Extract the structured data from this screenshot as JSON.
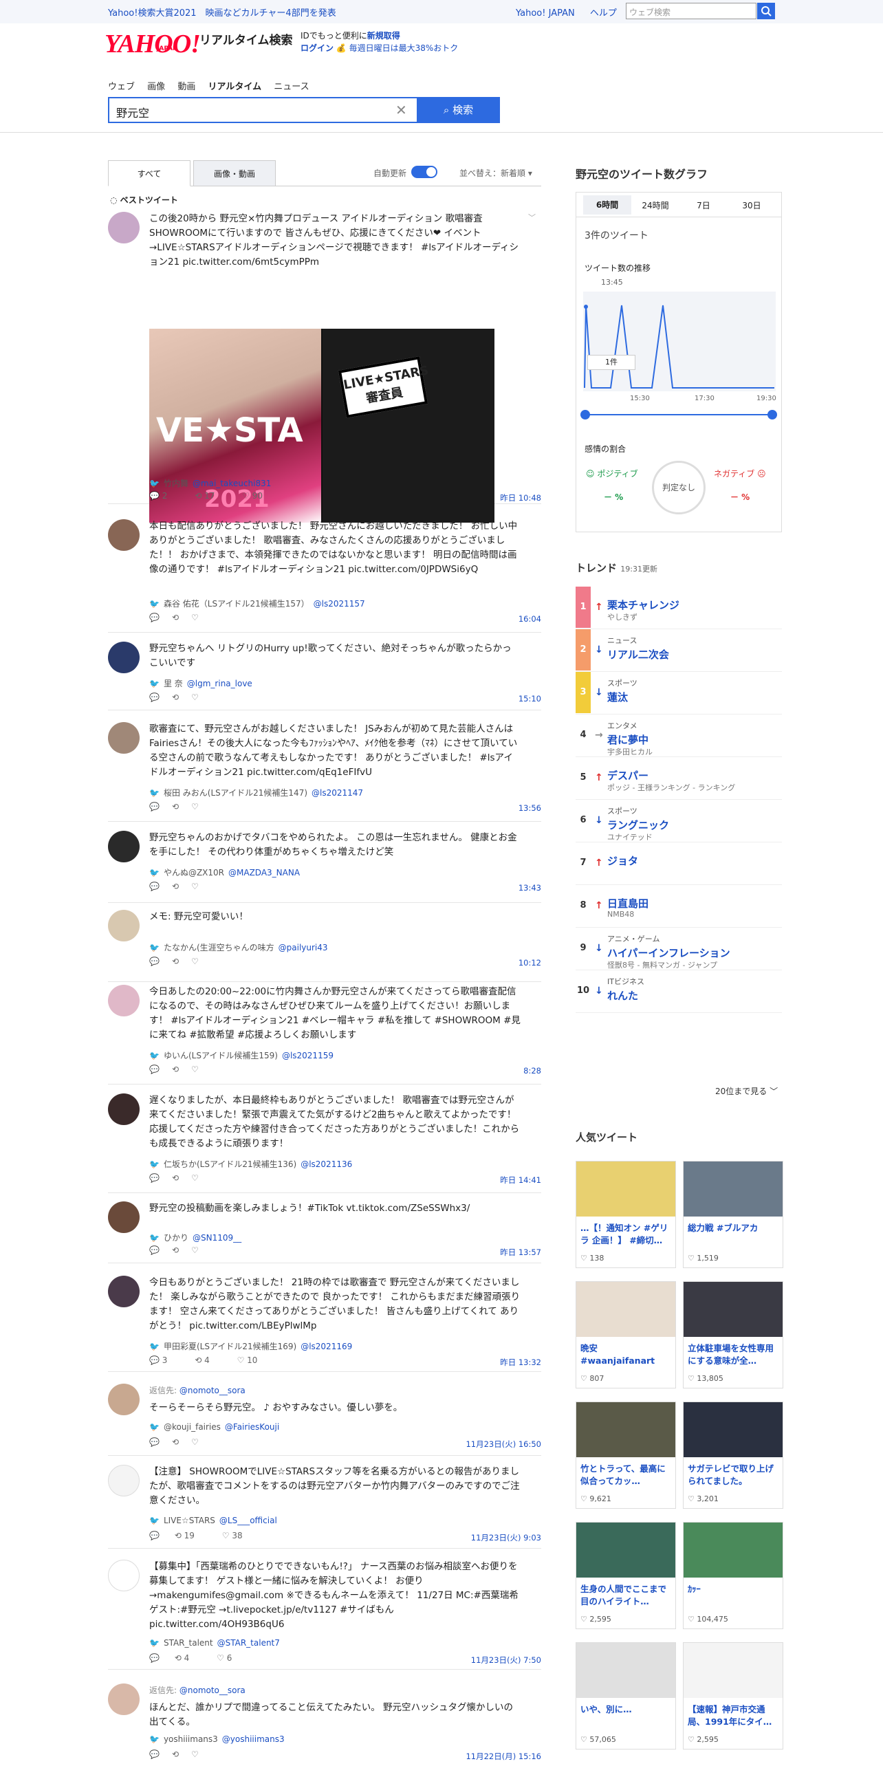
{
  "top": {
    "news": "Yahoo!検索大賞2021　映画などカルチャー4部門を発表",
    "links": [
      "Yahoo! JAPAN",
      "ヘルプ"
    ],
    "web_search_placeholder": "ウェブ検索"
  },
  "header": {
    "logo": "YAHOO!",
    "logo_sub": "JAPAN",
    "title": "リアルタイム検索",
    "promo_line1": "IDでもっと便利に",
    "promo_link1": "新規取得",
    "promo_link2": "ログイン",
    "promo_line2": "毎週日曜日は最大38%おトク"
  },
  "nav": {
    "tabs": [
      "ウェブ",
      "画像",
      "動画",
      "リアルタイム",
      "ニュース"
    ]
  },
  "search": {
    "query": "野元空",
    "button": "検索"
  },
  "filters": {
    "tab_all": "すべて",
    "tab_media": "画像・動画",
    "auto_update": "自動更新",
    "sort": "並べ替え：新着順",
    "best_tweets": "ベストツイート"
  },
  "tweets": [
    {
      "text": "この後20時から 野元空×竹内舞プロデュース アイドルオーディション 歌唱審査 SHOWROOMにて行いますので 皆さんもぜひ、応援にきてください❤︎ イベント→LIVE☆STARSアイドルオーディションページで視聴できます！ #lsアイドルオーディション21 pic.twitter.com/6mt5cymPPm",
      "author": "竹内舞",
      "handle": "@mai_takeuchi831",
      "replies": "2",
      "retweets": "17",
      "likes": "90",
      "time": "昨日 10:48",
      "img_sign": "LIVE★STARS 審査員",
      "img_big": "VE★STA",
      "img_year": "2021"
    },
    {
      "text": "本日も配信ありがとうございました！ 野元空さんにお越しいただきました！ お忙しい中ありがとうございました！ 歌唱審査、みなさんたくさんの応援ありがとうございました！！ おかげさまで、本領発揮できたのではないかなと思います！ 明日の配信時間は画像の通りです！ #lsアイドルオーディション21 pic.twitter.com/0JPDWSi6yQ",
      "author": "森谷 佑花（LSアイドル21候補生157）",
      "handle": "@ls2021157",
      "time": "16:04"
    },
    {
      "text": "野元空ちゃんへ リトグリのHurry up!歌ってください、絶対そっちゃんが歌ったらかっこいいです",
      "author": "里 奈",
      "handle": "@lgm_rina_love",
      "time": "15:10"
    },
    {
      "text": "歌審査にて、野元空さんがお越しくださいました！ JSみおんが初めて見た芸能人さんはFairiesさん！その後大人になった今もﾌｧｯｼｮﾝやﾍｱ、ﾒｲｸ他を参考（ﾏﾈ）にさせて頂いている空さんの前で歌うなんて考えもしなかったです！ ありがとうございました！ #lsアイドルオーディション21 pic.twitter.com/qEq1eFIfvU",
      "author": "桜田 みおん(LSアイドル21候補生147)",
      "handle": "@ls2021147",
      "time": "13:56"
    },
    {
      "text": "野元空ちゃんのおかげでタバコをやめられたよ。 この恩は一生忘れません。 健康とお金を手にした！ その代わり体重がめちゃくちゃ増えたけど笑",
      "author": "やんぬ@ZX10R",
      "handle": "@MAZDA3_NANA",
      "time": "13:43"
    },
    {
      "text": "メモ: 野元空可愛いい！",
      "author": "たなかん(生涯空ちゃんの味方",
      "handle": "@pailyuri43",
      "time": "10:12"
    },
    {
      "text": "今日あしたの20:00~22:00に竹内舞さんか野元空さんが来てくださってら歌唱審査配信になるので、その時はみなさんぜひぜひ来てルームを盛り上げてください！お願いします！ #lsアイドルオーディション21 #ベレー帽キャラ #私を推して #SHOWROOM #見に来てね #拡散希望 #応援よろしくお願いします",
      "author": "ゆいん(LSアイドル候補生159)",
      "handle": "@ls2021159",
      "time": "8:28"
    },
    {
      "text": "遅くなりましたが、本日最終枠もありがとうございました！ 歌唱審査では野元空さんが来てくださいました！緊張で声震えてた気がするけど2曲ちゃんと歌えてよかったです！ 応援してくださった方や練習付き合ってくださった方ありがとうございました！これからも成長できるように頑張ります！",
      "author": "仁坂ちか(LSアイドル21候補生136)",
      "handle": "@ls2021136",
      "time": "昨日 14:41"
    },
    {
      "text": "野元空の投稿動画を楽しみましょう！#TikTok vt.tiktok.com/ZSeSSWhx3/",
      "author": "ひかり",
      "handle": "@SN1109__",
      "time": "昨日 13:57"
    },
    {
      "text": "今日もありがとうございました！ 21時の枠では歌審査で 野元空さんが来てくださいました！ 楽しみながら歌うことができたので 良かったです！ これからもまだまだ練習頑張ります！ 空さん来てくださってありがとうございました！ 皆さんも盛り上げてくれて ありがとう！ pic.twitter.com/LBEyPlwlMp",
      "author": "甲田彩夏(LSアイドル21候補生169)",
      "handle": "@ls2021169",
      "retweets": "4",
      "replies": "3",
      "likes": "10",
      "time": "昨日 13:32"
    },
    {
      "reply_to": "@nomoto__sora",
      "reply_label": "返信先:",
      "text": "そーらそーらそら野元空。 ♪ おやすみなさい。優しい夢を。",
      "author": "@kouji_fairies",
      "handle": "@FairiesKouji",
      "time": "11月23日(火) 16:50"
    },
    {
      "text": "【注意】 SHOWROOMでLIVE☆STARSスタッフ等を名乗る方がいるとの報告がありましたが、歌唱審査でコメントをするのは野元空アバターか竹内舞アバターのみですのでご注意ください。",
      "author": "LIVE☆STARS",
      "handle": "@LS___official",
      "retweets": "19",
      "likes": "38",
      "time": "11月23日(火) 9:03"
    },
    {
      "text": "【募集中】「西葉瑞希のひとりでできないもん!?」 ナース西葉のお悩み相談室へお便りを募集してます！ ゲスト様と一緒に悩みを解決していくよ！ お便り→makengumifes@gmail.com ※できるもんネームを添えて！ 11/27日 MC:#西葉瑞希 ゲスト:#野元空 →t.livepocket.jp/e/tv1127 #サイばもん pic.twitter.com/4OH93B6qU6",
      "author": "STAR_talent",
      "handle": "@STAR_talent7",
      "retweets": "4",
      "likes": "6",
      "time": "11月23日(火) 7:50"
    },
    {
      "reply_to": "@nomoto__sora",
      "reply_label": "返信先:",
      "text": "ほんとだ、誰かリプで間違ってること伝えてたみたい。 野元空ハッシュタグ懐かしいの出てくる。",
      "author": "yoshiiimans3",
      "handle": "@yoshiiimans3",
      "time": "11月22日(月) 15:16"
    }
  ],
  "graph": {
    "title": "野元空のツイート数グラフ",
    "tabs": [
      "6時間",
      "24時間",
      "7日",
      "30日"
    ],
    "count": "3件のツイート",
    "trend_label": "ツイート数の推移",
    "time_label": "13:45",
    "tooltip": "1件",
    "x_ticks": [
      "15:30",
      "17:30",
      "19:30"
    ],
    "sentiment_label": "感情の割合",
    "positive": "ポジティブ",
    "negative": "ネガティブ",
    "judge": "判定なし",
    "pos_pct": "－ %",
    "neg_pct": "－ %"
  },
  "trends": {
    "title": "トレンド",
    "updated": "19:31更新",
    "items": [
      {
        "rank": "1",
        "dir": "up",
        "cat": "",
        "name": "栗本チャレンジ",
        "sub": "やしきず",
        "color": "#f07a8a"
      },
      {
        "rank": "2",
        "dir": "down",
        "cat": "ニュース",
        "name": "リアル二次会",
        "sub": "",
        "color": "#f59c6a"
      },
      {
        "rank": "3",
        "dir": "down",
        "cat": "スポーツ",
        "name": "蓮汰",
        "sub": "",
        "color": "#f2cc3a"
      },
      {
        "rank": "4",
        "dir": "flat",
        "cat": "エンタメ",
        "name": "君に夢中",
        "sub": "宇多田ヒカル",
        "color": ""
      },
      {
        "rank": "5",
        "dir": "up",
        "cat": "",
        "name": "デスパー",
        "sub": "ポッジ - 王様ランキング - ランキング",
        "color": ""
      },
      {
        "rank": "6",
        "dir": "down",
        "cat": "スポーツ",
        "name": "ラングニック",
        "sub": "ユナイテッド",
        "color": ""
      },
      {
        "rank": "7",
        "dir": "up",
        "cat": "",
        "name": "ジョタ",
        "sub": "",
        "color": ""
      },
      {
        "rank": "8",
        "dir": "up",
        "cat": "",
        "name": "日直島田",
        "sub": "NMB48",
        "color": ""
      },
      {
        "rank": "9",
        "dir": "down",
        "cat": "アニメ・ゲーム",
        "name": "ハイパーインフレーション",
        "sub": "怪獣8号 - 無料マンガ - ジャンプ",
        "color": ""
      },
      {
        "rank": "10",
        "dir": "down",
        "cat": "ITビジネス",
        "name": "れんた",
        "sub": "",
        "color": ""
      }
    ],
    "more": "20位まで見る"
  },
  "popular": {
    "title": "人気ツイート",
    "cards": [
      {
        "title": "…【！通知オン #ゲリラ 企画！】 #締切…",
        "likes": "138",
        "bg": "#e8d070"
      },
      {
        "title": "総力戦 #ブルアカ",
        "likes": "1,519",
        "bg": "#6a7a8a"
      },
      {
        "title": "晩安 #waanjaifanart",
        "likes": "807",
        "bg": "#e8ddd0"
      },
      {
        "title": "立体駐車場を女性専用にする意味が全…",
        "likes": "13,805",
        "bg": "#3a3a44"
      },
      {
        "title": "竹とトラって、最高に似合ってカッ…",
        "likes": "9,621",
        "bg": "#5a5a48"
      },
      {
        "title": "サガテレビで取り上げられてました。",
        "likes": "3,201",
        "bg": "#2a3040"
      },
      {
        "title": "生身の人間でここまで目のハイライト…",
        "likes": "2,595",
        "bg": "#3a6a5a"
      },
      {
        "title": "ｶｯｰ",
        "likes": "104,475",
        "bg": "#4a8a5a"
      },
      {
        "title": "いや、別に…",
        "likes": "57,065",
        "bg": "#e0e0e0"
      },
      {
        "title": "【速報】神戸市交通局、1991年にタイ…",
        "likes": "2,595",
        "bg": "#f4f4f4"
      }
    ]
  }
}
